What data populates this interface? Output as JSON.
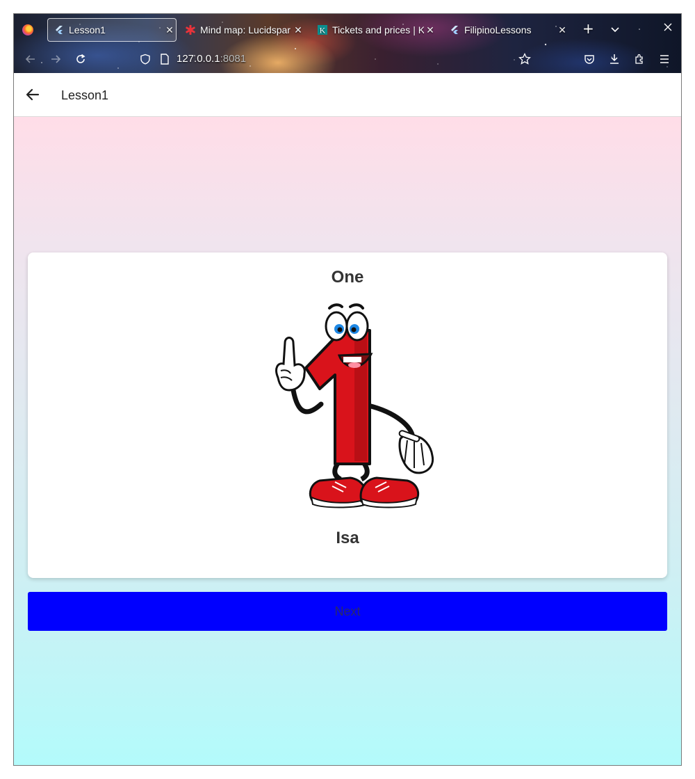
{
  "browser": {
    "tabs": [
      {
        "title": "Lesson1",
        "icon": "flutter-icon",
        "active": true
      },
      {
        "title": "Mind map: Lucidspar",
        "icon": "lucid-icon",
        "active": false
      },
      {
        "title": "Tickets and prices | K",
        "icon": "k-icon",
        "active": false
      },
      {
        "title": "FilipinoLessons",
        "icon": "flutter-icon",
        "active": false
      }
    ],
    "url_host": "127.0.0.1",
    "url_port": ":8081"
  },
  "app": {
    "title": "Lesson1"
  },
  "lesson": {
    "english_word": "One",
    "filipino_word": "Isa",
    "image": "number-one-cartoon-mascot",
    "next_label": "Next"
  },
  "colors": {
    "next_button": "#0000ff",
    "background_top": "#ffdde8",
    "background_bottom": "#b3fbfb"
  }
}
